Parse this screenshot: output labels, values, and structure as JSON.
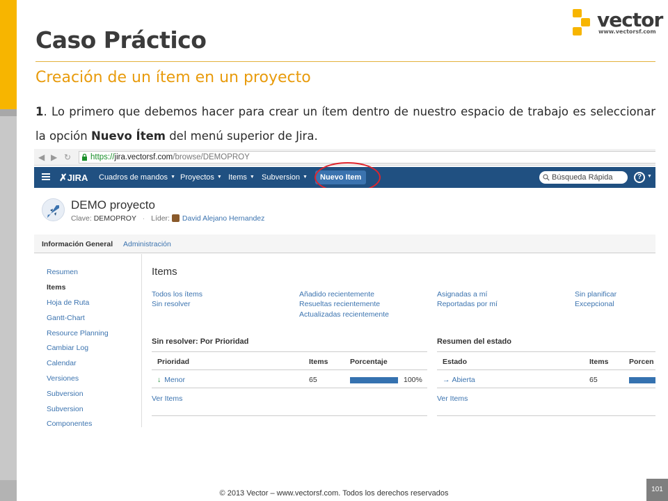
{
  "slide": {
    "title": "Caso Práctico",
    "subtitle": "Creación de un ítem en un proyecto",
    "step_number": "1",
    "step_text_before": ". Lo primero que debemos hacer para crear un ítem dentro de nuestro espacio de trabajo es seleccionar la opción ",
    "step_bold": "Nuevo Ítem",
    "step_text_after": " del menú superior de Jira.",
    "footer": "© 2013 Vector – www.vectorsf.com. Todos los derechos reservados",
    "page_number": "101",
    "logo_word": "vector",
    "logo_url": "www.vectorsf.com",
    "accent_color": "#f7b500",
    "subtitle_color": "#e89b0c"
  },
  "browser": {
    "url_scheme": "https://",
    "url_domain": "jira.vectorsf.com",
    "url_path": "/browse/DEMOPROY"
  },
  "jira": {
    "logo": "JIRA",
    "nav": {
      "dashboards": "Cuadros de mandos",
      "projects": "Proyectos",
      "items": "Items",
      "subversion": "Subversion",
      "new_item": "Nuevo Item"
    },
    "search_placeholder": "Búsqueda Rápida",
    "help": "?",
    "nav_color": "#205081",
    "project": {
      "name": "DEMO proyecto",
      "key_label": "Clave:",
      "key": "DEMOPROY",
      "lead_label": "Líder:",
      "lead": "David Alejano Hernandez"
    },
    "tabs": {
      "active": "Información General",
      "other": "Administración"
    },
    "sidebar": [
      {
        "label": "Resumen"
      },
      {
        "label": "Items"
      },
      {
        "label": "Hoja de Ruta"
      },
      {
        "label": "Gantt-Chart"
      },
      {
        "label": "Resource Planning"
      },
      {
        "label": "Cambiar Log"
      },
      {
        "label": "Calendar"
      },
      {
        "label": "Versiones"
      },
      {
        "label": "Subversion"
      },
      {
        "label": "Subversion"
      },
      {
        "label": "Componentes"
      }
    ],
    "main": {
      "title": "Items",
      "filters": [
        [
          "Todos los ítems",
          "Sin resolver"
        ],
        [
          "Añadido recientemente",
          "Resueltas recientemente",
          "Actualizadas recientemente"
        ],
        [
          "Asignadas a mí",
          "Reportadas por mí"
        ],
        [
          "Sin planificar",
          "Excepcional"
        ]
      ],
      "unresolved": {
        "title": "Sin resolver: Por Prioridad",
        "headers": [
          "Prioridad",
          "Items",
          "Porcentaje"
        ],
        "row": {
          "priority": "Menor",
          "count": "65",
          "percent_label": "100%",
          "percent": 100
        },
        "view_link": "Ver Items"
      },
      "status_summary": {
        "title": "Resumen del estado",
        "headers": [
          "Estado",
          "Items",
          "Porcen"
        ],
        "row": {
          "status": "Abierta",
          "count": "65",
          "percent": 100
        },
        "view_link": "Ver Items"
      }
    }
  }
}
